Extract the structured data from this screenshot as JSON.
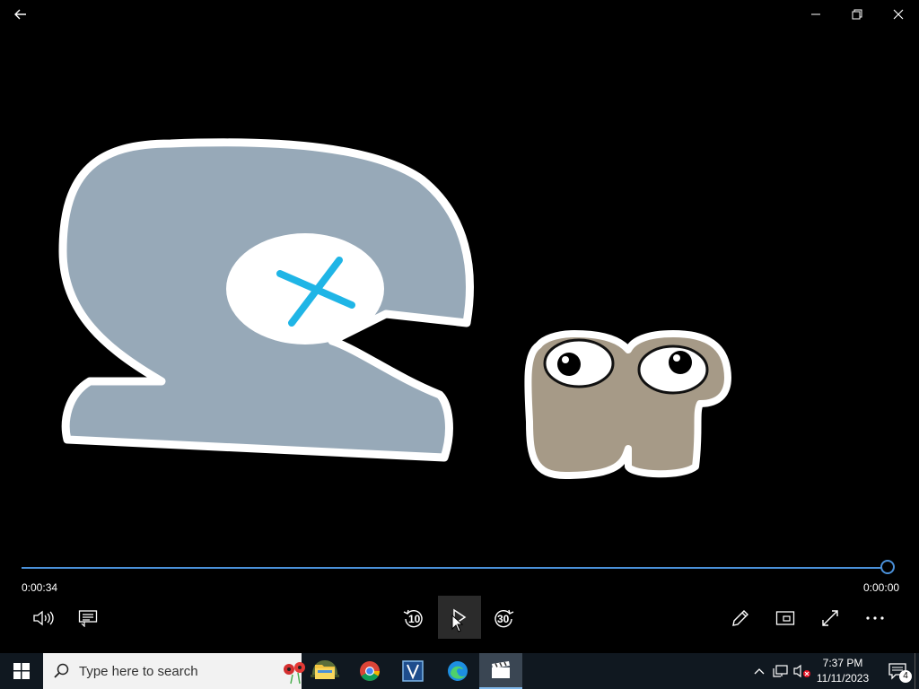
{
  "window": {
    "back_icon": "back-arrow-icon",
    "minimize_icon": "minimize-icon",
    "restore_icon": "restore-icon",
    "close_icon": "close-icon"
  },
  "player": {
    "elapsed": "0:00:34",
    "remaining": "0:00:00",
    "progress": 1.0,
    "skip_back_label": "10",
    "skip_forward_label": "30",
    "accent": "#4a90d9"
  },
  "taskbar": {
    "search_placeholder": "Type here to search",
    "time": "7:37 PM",
    "date": "11/11/2023",
    "notification_count": "4",
    "apps": [
      "file-explorer",
      "chrome",
      "visio",
      "edge",
      "movies-and-tv"
    ]
  }
}
